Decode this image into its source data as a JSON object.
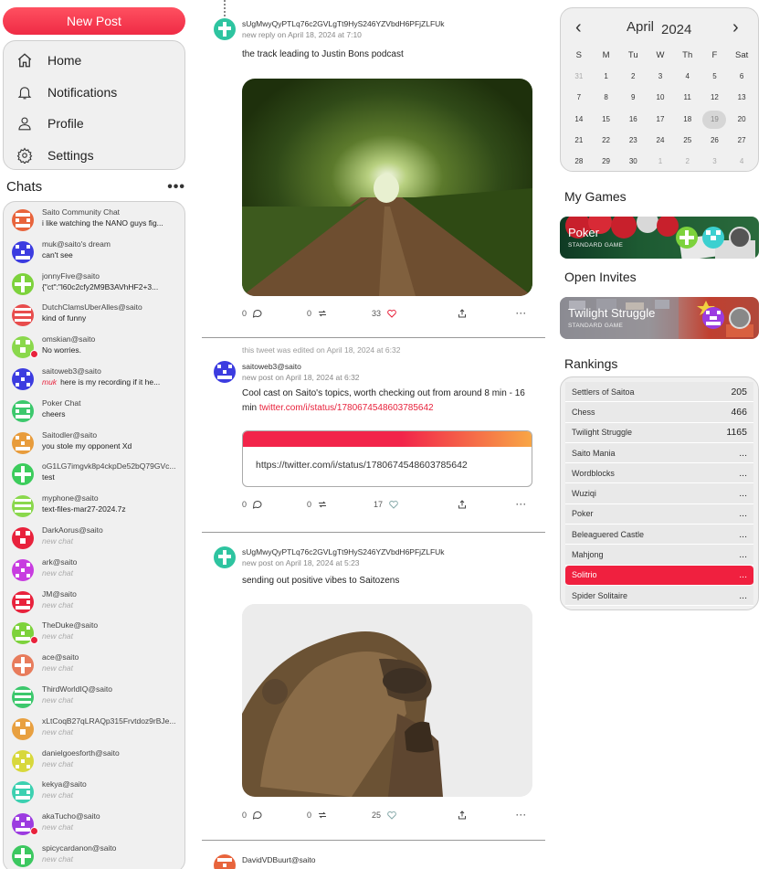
{
  "nav": {
    "new_post": "New Post",
    "items": [
      {
        "label": "Home",
        "icon": "home-icon"
      },
      {
        "label": "Notifications",
        "icon": "bell-icon"
      },
      {
        "label": "Profile",
        "icon": "user-icon"
      },
      {
        "label": "Settings",
        "icon": "gear-icon"
      }
    ]
  },
  "chats": {
    "title": "Chats",
    "more": "•••",
    "items": [
      {
        "name": "Saito Community Chat",
        "msg": "i like watching the NANO guys fig...",
        "color": "#e8643c"
      },
      {
        "name": "muk@saito's dream",
        "msg": "can't see",
        "color": "#3c3ce0"
      },
      {
        "name": "jonnyFive@saito",
        "msg": "{\"ct\":\"l60c2cfy2M9B3AVhHF2+3...",
        "color": "#7dd23c"
      },
      {
        "name": "DutchClamsUberAlles@saito",
        "msg": "kind of funny",
        "color": "#e84c4c"
      },
      {
        "name": "omskian@saito",
        "msg": "No worries.",
        "color": "#8ad84c",
        "unread": true
      },
      {
        "name": "saitoweb3@saito",
        "sender": "muk",
        "msg": "here is my recording if it he...",
        "color": "#3c3ce0"
      },
      {
        "name": "Poker Chat",
        "msg": "cheers",
        "color": "#3cc86c"
      },
      {
        "name": "Saitodler@saito",
        "msg": "you stole my opponent Xd",
        "color": "#e89c3c"
      },
      {
        "name": "oG1LG7imgvk8p4ckpDe52bQ79GVc...",
        "msg": "test",
        "color": "#3ccc5c"
      },
      {
        "name": "myphone@saito",
        "msg": "text-files-mar27-2024.7z",
        "color": "#8ad84c"
      },
      {
        "name": "DarkAorus@saito",
        "msg": "new chat",
        "color": "#e8223c",
        "new": true
      },
      {
        "name": "ark@saito",
        "msg": "new chat",
        "color": "#c83ce0",
        "new": true
      },
      {
        "name": "JM@saito",
        "msg": "new chat",
        "color": "#e8223c",
        "new": true
      },
      {
        "name": "TheDuke@saito",
        "msg": "new chat",
        "color": "#7dd23c",
        "new": true,
        "unread": true
      },
      {
        "name": "ace@saito",
        "msg": "new chat",
        "color": "#e87c5c",
        "new": true
      },
      {
        "name": "ThirdWorldIQ@saito",
        "msg": "new chat",
        "color": "#3cc86c",
        "new": true
      },
      {
        "name": "xLtCoqB27qLRAQp315Frvtdoz9rBJe...",
        "msg": "new chat",
        "color": "#e8a040",
        "new": true
      },
      {
        "name": "danielgoesforth@saito",
        "msg": "new chat",
        "color": "#d8d83c",
        "new": true
      },
      {
        "name": "kekya@saito",
        "msg": "new chat",
        "color": "#3cd0b0",
        "new": true
      },
      {
        "name": "akaTucho@saito",
        "msg": "new chat",
        "color": "#9c3ce0",
        "new": true,
        "unread": true
      },
      {
        "name": "spicycardanon@saito",
        "msg": "new chat",
        "color": "#3cc860",
        "new": true
      }
    ]
  },
  "feed": {
    "posts": [
      {
        "author": "sUgMwyQyPTLq76c2GVLgTt9HyS246YZVbdH6PFjZLFUk",
        "meta": "new reply on April 18, 2024 at 7:10",
        "body": "the track leading to Justin Bons podcast",
        "comments": "0",
        "retweets": "0",
        "likes": "33",
        "liked": true,
        "color": "#2ec4a0"
      },
      {
        "edited": "this tweet was edited on April 18, 2024 at 6:32",
        "author": "saitoweb3@saito",
        "meta": "new post on April 18, 2024 at 6:32",
        "body": "Cool cast on Saito's topics, worth checking out from around 8 min - 16 min",
        "link": "twitter.com/i/status/1780674548603785642",
        "card_url": "https://twitter.com/i/status/1780674548603785642",
        "comments": "0",
        "retweets": "0",
        "likes": "17",
        "color": "#3c3ce0"
      },
      {
        "author": "sUgMwyQyPTLq76c2GVLgTt9HyS246YZVbdH6PFjZLFUk",
        "meta": "new post on April 18, 2024 at 5:23",
        "body": "sending out positive vibes to Saitozens",
        "comments": "0",
        "retweets": "0",
        "likes": "25",
        "color": "#2ec4a0"
      },
      {
        "author": "DavidVDBuurt@saito",
        "color": "#e8643c"
      }
    ]
  },
  "calendar": {
    "month": "April",
    "year": "2024",
    "prev": "‹",
    "next": "›",
    "dow": [
      "S",
      "M",
      "Tu",
      "W",
      "Th",
      "F",
      "Sat"
    ],
    "days": [
      "31",
      "1",
      "2",
      "3",
      "4",
      "5",
      "6",
      "7",
      "8",
      "9",
      "10",
      "11",
      "12",
      "13",
      "14",
      "15",
      "16",
      "17",
      "18",
      "19",
      "20",
      "21",
      "22",
      "23",
      "24",
      "25",
      "26",
      "27",
      "28",
      "29",
      "30",
      "1",
      "2",
      "3",
      "4"
    ],
    "muted_days": [
      0,
      31,
      32,
      33,
      34
    ],
    "today_index": 19
  },
  "my_games": {
    "title": "My Games",
    "games": [
      {
        "name": "Poker",
        "sub": "STANDARD GAME"
      }
    ]
  },
  "open_invites": {
    "title": "Open Invites",
    "games": [
      {
        "name": "Twilight Struggle",
        "sub": "STANDARD GAME"
      }
    ]
  },
  "rankings": {
    "title": "Rankings",
    "rows": [
      {
        "name": "Settlers of Saitoa",
        "value": "205"
      },
      {
        "name": "Chess",
        "value": "466"
      },
      {
        "name": "Twilight Struggle",
        "value": "1165"
      },
      {
        "name": "Saito Mania",
        "value": "..."
      },
      {
        "name": "Wordblocks",
        "value": "..."
      },
      {
        "name": "Wuziqi",
        "value": "..."
      },
      {
        "name": "Poker",
        "value": "..."
      },
      {
        "name": "Beleaguered Castle",
        "value": "..."
      },
      {
        "name": "Mahjong",
        "value": "..."
      },
      {
        "name": "Solitrio",
        "value": "...",
        "active": true
      },
      {
        "name": "Spider Solitaire",
        "value": "..."
      }
    ]
  },
  "colors": {
    "accent": "#ef2b45",
    "panel": "#f0f0f0",
    "link_gradient_end": "#f8a646"
  }
}
